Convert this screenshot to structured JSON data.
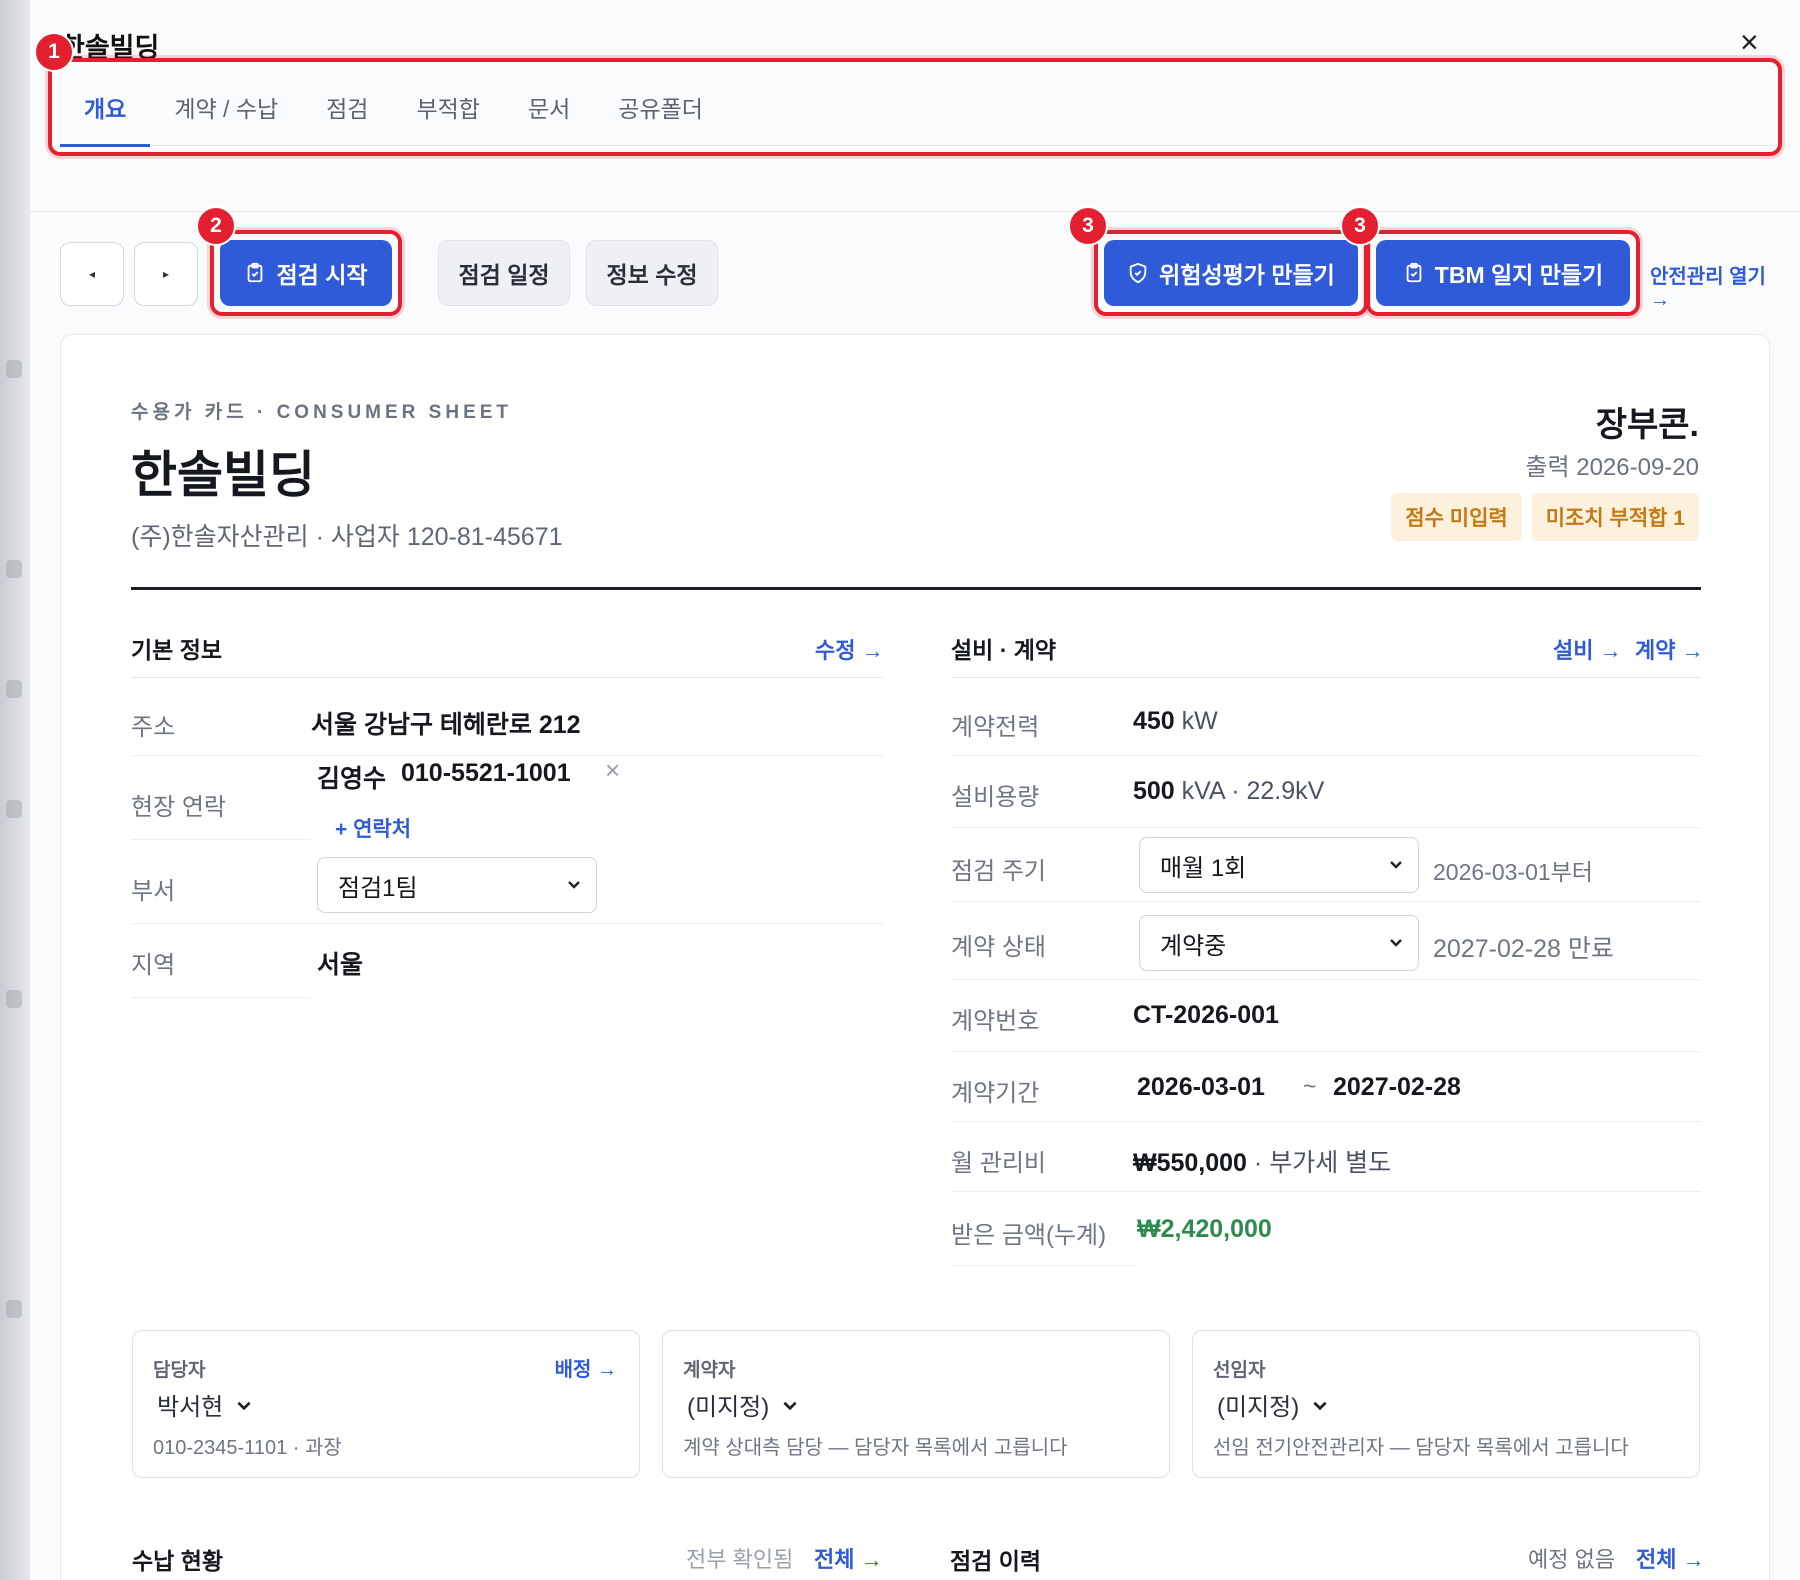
{
  "window": {
    "title": "한솔빌딩",
    "close_glyph": "×"
  },
  "tabs": [
    {
      "label": "개요",
      "active": true
    },
    {
      "label": "계약 / 수납"
    },
    {
      "label": "점검"
    },
    {
      "label": "부적합"
    },
    {
      "label": "문서"
    },
    {
      "label": "공유폴더"
    }
  ],
  "annotations": {
    "tabs": "1",
    "start": "2",
    "risk": "3",
    "tbm": "3"
  },
  "toolbar": {
    "prev_glyph": "◂",
    "next_glyph": "▸",
    "start_inspection": "점검 시작",
    "schedule": "점검 일정",
    "edit_info": "정보 수정",
    "risk_assessment": "위험성평가 만들기",
    "tbm_log": "TBM 일지 만들기",
    "open_safety": "안전관리 열기 →"
  },
  "card": {
    "eyebrow": "수용가 카드 · CONSUMER SHEET",
    "title": "한솔빌딩",
    "subtitle": "(주)한솔자산관리 · 사업자 120-81-45671",
    "brand": "장부콘.",
    "printed": "출력 2026-09-20",
    "badges": [
      "점수 미입력",
      "미조치 부적합 1"
    ]
  },
  "basic": {
    "heading": "기본 정보",
    "edit_link": "수정 →",
    "address_label": "주소",
    "address": "서울 강남구 테헤란로 212",
    "contact_label": "현장 연락",
    "contact_name": "김영수",
    "contact_phone": "010-5521-1001",
    "remove_glyph": "×",
    "add_contact": "+ 연락처",
    "dept_label": "부서",
    "dept_value": "점검1팀",
    "region_label": "지역",
    "region_value": "서울"
  },
  "facility": {
    "heading": "설비 · 계약",
    "link_facility": "설비 →",
    "link_contract": "계약 →",
    "power_label": "계약전력",
    "power_value": "450",
    "power_unit": "kW",
    "capacity_label": "설비용량",
    "capacity_value": "500",
    "capacity_unit": "kVA · 22.9kV",
    "cycle_label": "점검 주기",
    "cycle_value": "매월 1회",
    "cycle_note": "2026-03-01부터",
    "status_label": "계약 상태",
    "status_value": "계약중",
    "status_note": "2027-02-28 만료",
    "number_label": "계약번호",
    "number_value": "CT-2026-001",
    "period_label": "계약기간",
    "period_start": "2026-03-01",
    "period_sep": "~",
    "period_end": "2027-02-28",
    "fee_label": "월 관리비",
    "fee_value": "₩550,000",
    "fee_note": "· 부가세 별도",
    "received_label": "받은 금액(누계)",
    "received_value": "₩2,420,000"
  },
  "people": [
    {
      "title": "담당자",
      "value": "박서현",
      "desc": "010-2345-1101 · 과장",
      "link": "배정 →"
    },
    {
      "title": "계약자",
      "value": "(미지정)",
      "desc": "계약 상대측 담당 — 담당자 목록에서 고릅니다"
    },
    {
      "title": "선임자",
      "value": "(미지정)",
      "desc": "선임 전기안전관리자 — 담당자 목록에서 고릅니다"
    }
  ],
  "bottom": {
    "payment_heading": "수납 현황",
    "payment_note": "전부 확인됨",
    "payment_link": "전체 →",
    "history_heading": "점검 이력",
    "history_note": "예정 없음",
    "history_link": "전체 →"
  },
  "colors": {
    "accent": "#2f5bd8",
    "highlight": "#e3202f",
    "badge_bg": "#fdf0dc",
    "badge_text": "#c27b14",
    "money_green": "#2e8b4f"
  }
}
